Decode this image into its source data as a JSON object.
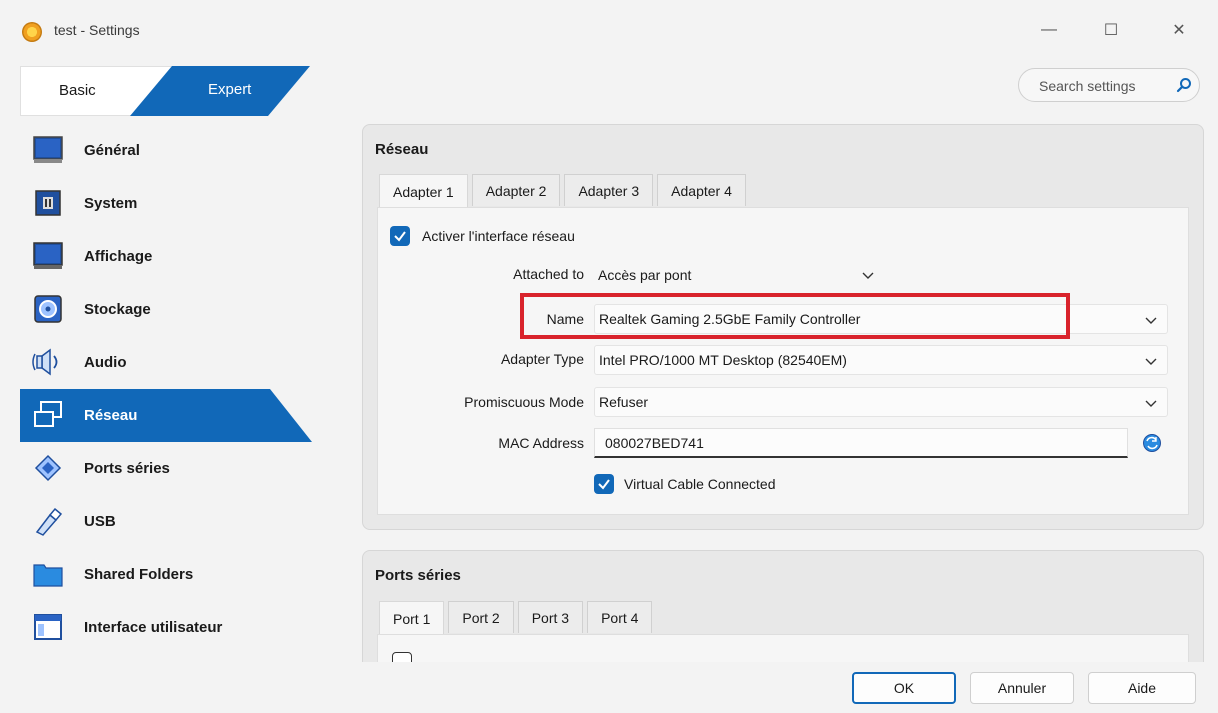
{
  "window": {
    "title": "test - Settings",
    "minimize": "—",
    "maximize": "☐",
    "close": "✕"
  },
  "mode": {
    "basic": "Basic",
    "expert": "Expert",
    "selected": "Expert"
  },
  "search": {
    "placeholder": "Search settings"
  },
  "sidebar": {
    "items": [
      {
        "label": "Général",
        "icon": "monitor-icon"
      },
      {
        "label": "System",
        "icon": "chip-icon"
      },
      {
        "label": "Affichage",
        "icon": "display-icon"
      },
      {
        "label": "Stockage",
        "icon": "disk-icon"
      },
      {
        "label": "Audio",
        "icon": "speaker-icon"
      },
      {
        "label": "Réseau",
        "icon": "network-icon",
        "active": true
      },
      {
        "label": "Ports séries",
        "icon": "serial-port-icon"
      },
      {
        "label": "USB",
        "icon": "usb-icon"
      },
      {
        "label": "Shared Folders",
        "icon": "folder-icon"
      },
      {
        "label": "Interface utilisateur",
        "icon": "window-icon"
      }
    ]
  },
  "network": {
    "title": "Réseau",
    "tabs": [
      "Adapter 1",
      "Adapter 2",
      "Adapter 3",
      "Adapter 4"
    ],
    "enable_label": "Activer l'interface réseau",
    "enable_checked": true,
    "attached_to_label": "Attached to",
    "attached_to_value": "Accès par pont",
    "name_label": "Name",
    "name_value": "Realtek Gaming 2.5GbE Family Controller",
    "adapter_type_label": "Adapter Type",
    "adapter_type_value": "Intel PRO/1000 MT Desktop (82540EM)",
    "promiscuous_label": "Promiscuous Mode",
    "promiscuous_value": "Refuser",
    "mac_label": "MAC Address",
    "mac_value": "080027BED741",
    "cable_label": "Virtual Cable Connected",
    "cable_checked": true
  },
  "serial": {
    "title": "Ports séries",
    "tabs": [
      "Port 1",
      "Port 2",
      "Port 3",
      "Port 4"
    ]
  },
  "buttons": {
    "ok": "OK",
    "cancel": "Annuler",
    "help": "Aide"
  },
  "colors": {
    "accent": "#1168b8",
    "highlight": "#d9232c"
  }
}
